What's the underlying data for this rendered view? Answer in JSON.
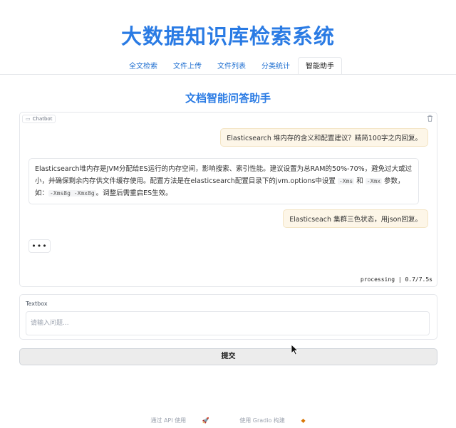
{
  "app": {
    "title": "大数据知识库检索系统"
  },
  "tabs": [
    {
      "label": "全文检索"
    },
    {
      "label": "文件上传"
    },
    {
      "label": "文件列表"
    },
    {
      "label": "分类统计"
    },
    {
      "label": "智能助手",
      "active": true
    }
  ],
  "section": {
    "heading": "文档智能问答助手"
  },
  "chatbot": {
    "label": "Chatbot",
    "messages": [
      {
        "role": "user",
        "text": "Elasticsearch 堆内存的含义和配置建议？精简100字之内回复。"
      },
      {
        "role": "assistant",
        "text_parts": [
          "Elasticsearch堆内存是JVM分配给ES运行的内存空间，影响搜索、索引性能。建议设置为总RAM的50%-70%，避免过大或过小，并确保剩余内存供文件缓存使用。配置方法是在elasticsearch配置目录下的jvm.options中设置 ",
          "-Xms",
          " 和 ",
          "-Xmx",
          " 参数，如：",
          "-Xms8g -Xmx8g",
          "。调整后需重启ES生效。"
        ]
      },
      {
        "role": "user",
        "text": "Elasticseach 集群三色状态，用json回复。"
      }
    ],
    "typing_indicator": "•••",
    "status": "processing | 0.7/7.5s"
  },
  "input": {
    "label": "Textbox",
    "placeholder": "请输入问题...",
    "value": ""
  },
  "submit": {
    "label": "提交"
  },
  "footer": {
    "api_link": "通过 API 使用",
    "built_with": "使用 Gradio 构建"
  },
  "icons": {
    "chat": "chat-bubble-icon",
    "trash": "trash-icon",
    "cursor": "mouse-pointer-icon",
    "rocket": "rocket-icon",
    "gradio": "gradio-logo-icon"
  },
  "colors": {
    "accent": "#2a7be4",
    "user_bubble": "#fdf6e8",
    "submit_bg": "#ececec"
  }
}
